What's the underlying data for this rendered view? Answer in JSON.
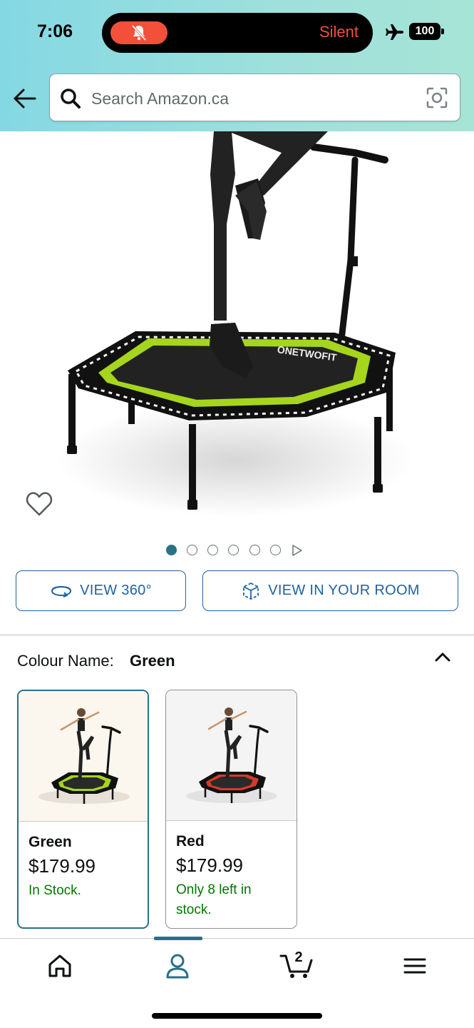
{
  "status_bar": {
    "time": "7:06",
    "silent_label": "Silent",
    "battery": "100",
    "icons": [
      "bell-slash-icon",
      "airplane-icon",
      "battery-icon"
    ]
  },
  "search": {
    "placeholder": "Search Amazon.ca",
    "icons": [
      "back-arrow-icon",
      "search-icon",
      "camera-lens-icon"
    ]
  },
  "product": {
    "image_alt": "Hexagonal fitness trampoline with handlebar",
    "brand_mark": "ONETWOFIT",
    "image_count": 6,
    "active_image": 1
  },
  "actions": {
    "view_360": "VIEW 360°",
    "view_in_room": "VIEW IN YOUR ROOM"
  },
  "variation": {
    "label": "Colour Name:",
    "selected": "Green",
    "options": [
      {
        "name": "Green",
        "price": "$179.99",
        "stock": "In Stock.",
        "accent": "#a6d51e"
      },
      {
        "name": "Red",
        "price": "$179.99",
        "stock": "Only 8 left in stock.",
        "accent": "#d63a2b"
      }
    ]
  },
  "bottom_nav": {
    "items": [
      "home-icon",
      "account-icon",
      "cart-icon",
      "menu-icon"
    ],
    "active": "account-icon",
    "cart_count": "2"
  },
  "colors": {
    "accent": "#287187",
    "link": "#2162a1",
    "stock_green": "#007600",
    "silent_red": "#f2503b"
  }
}
